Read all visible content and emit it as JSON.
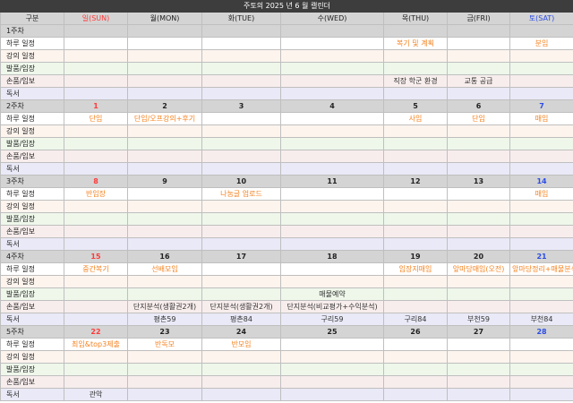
{
  "title": "주토의 2025 년 6 월 캘린더",
  "header": {
    "category": "구분",
    "days": [
      {
        "label": "일(SUN)",
        "color": "sun"
      },
      {
        "label": "월(MON)",
        "color": ""
      },
      {
        "label": "화(TUE)",
        "color": ""
      },
      {
        "label": "수(WED)",
        "color": ""
      },
      {
        "label": "목(THU)",
        "color": ""
      },
      {
        "label": "금(FRI)",
        "color": ""
      },
      {
        "label": "토(SAT)",
        "color": "sat"
      }
    ]
  },
  "row_labels": [
    "하루 일정",
    "강의 일정",
    "발품/임장",
    "손품/임보",
    "독서"
  ],
  "colors": {
    "header_bg": "#d4d4d4",
    "title_bg": "#3d3d3d",
    "sunday": "#ff3a3a",
    "saturday": "#2c4de6",
    "event": "#f5821f"
  },
  "weeks": [
    {
      "label": "1주차",
      "days": [
        "",
        "",
        "",
        "",
        "",
        "",
        ""
      ],
      "rows": [
        [
          "",
          "",
          "",
          "",
          "복기 및 계획",
          "",
          "분임"
        ],
        [
          "",
          "",
          "",
          "",
          "",
          "",
          ""
        ],
        [
          "",
          "",
          "",
          "",
          "",
          "",
          ""
        ],
        [
          "",
          "",
          "",
          "",
          "직장 학군 환경",
          "교통 공급",
          ""
        ],
        [
          "",
          "",
          "",
          "",
          "",
          "",
          ""
        ]
      ]
    },
    {
      "label": "2주차",
      "days": [
        "1",
        "2",
        "3",
        "4",
        "5",
        "6",
        "7"
      ],
      "rows": [
        [
          "단임",
          "단임/오프강의+후기",
          "",
          "",
          "사임",
          "단임",
          "매임"
        ],
        [
          "",
          "",
          "",
          "",
          "",
          "",
          ""
        ],
        [
          "",
          "",
          "",
          "",
          "",
          "",
          ""
        ],
        [
          "",
          "",
          "",
          "",
          "",
          "",
          ""
        ],
        [
          "",
          "",
          "",
          "",
          "",
          "",
          ""
        ]
      ]
    },
    {
      "label": "3주차",
      "days": [
        "8",
        "9",
        "10",
        "11",
        "12",
        "13",
        "14"
      ],
      "rows": [
        [
          "반임장",
          "",
          "나눔글 업로드",
          "",
          "",
          "",
          "매임"
        ],
        [
          "",
          "",
          "",
          "",
          "",
          "",
          ""
        ],
        [
          "",
          "",
          "",
          "",
          "",
          "",
          ""
        ],
        [
          "",
          "",
          "",
          "",
          "",
          "",
          ""
        ],
        [
          "",
          "",
          "",
          "",
          "",
          "",
          ""
        ]
      ]
    },
    {
      "label": "4주차",
      "days": [
        "15",
        "16",
        "17",
        "18",
        "19",
        "20",
        "21"
      ],
      "rows": [
        [
          "중간복기",
          "선배모임",
          "",
          "",
          "임장지매임",
          "앞마당매임(오전)",
          "앞마당정리+매물분석"
        ],
        [
          "",
          "",
          "",
          "",
          "",
          "",
          ""
        ],
        [
          "",
          "",
          "",
          "매물예약",
          "",
          "",
          ""
        ],
        [
          "",
          "단지분석(생활권2개)",
          "단지분석(생활권2개)",
          "단지분석(비교평가+수익분석)",
          "",
          "",
          ""
        ],
        [
          "",
          "평촌59",
          "평촌84",
          "구리59",
          "구리84",
          "부천59",
          "부천84"
        ]
      ]
    },
    {
      "label": "5주차",
      "days": [
        "22",
        "23",
        "24",
        "25",
        "26",
        "27",
        "28"
      ],
      "rows": [
        [
          "최임&top3제출",
          "반독모",
          "반모임",
          "",
          "",
          "",
          ""
        ],
        [
          "",
          "",
          "",
          "",
          "",
          "",
          ""
        ],
        [
          "",
          "",
          "",
          "",
          "",
          "",
          ""
        ],
        [
          "",
          "",
          "",
          "",
          "",
          "",
          ""
        ],
        [
          "관악",
          "",
          "",
          "",
          "",
          "",
          ""
        ]
      ]
    }
  ]
}
